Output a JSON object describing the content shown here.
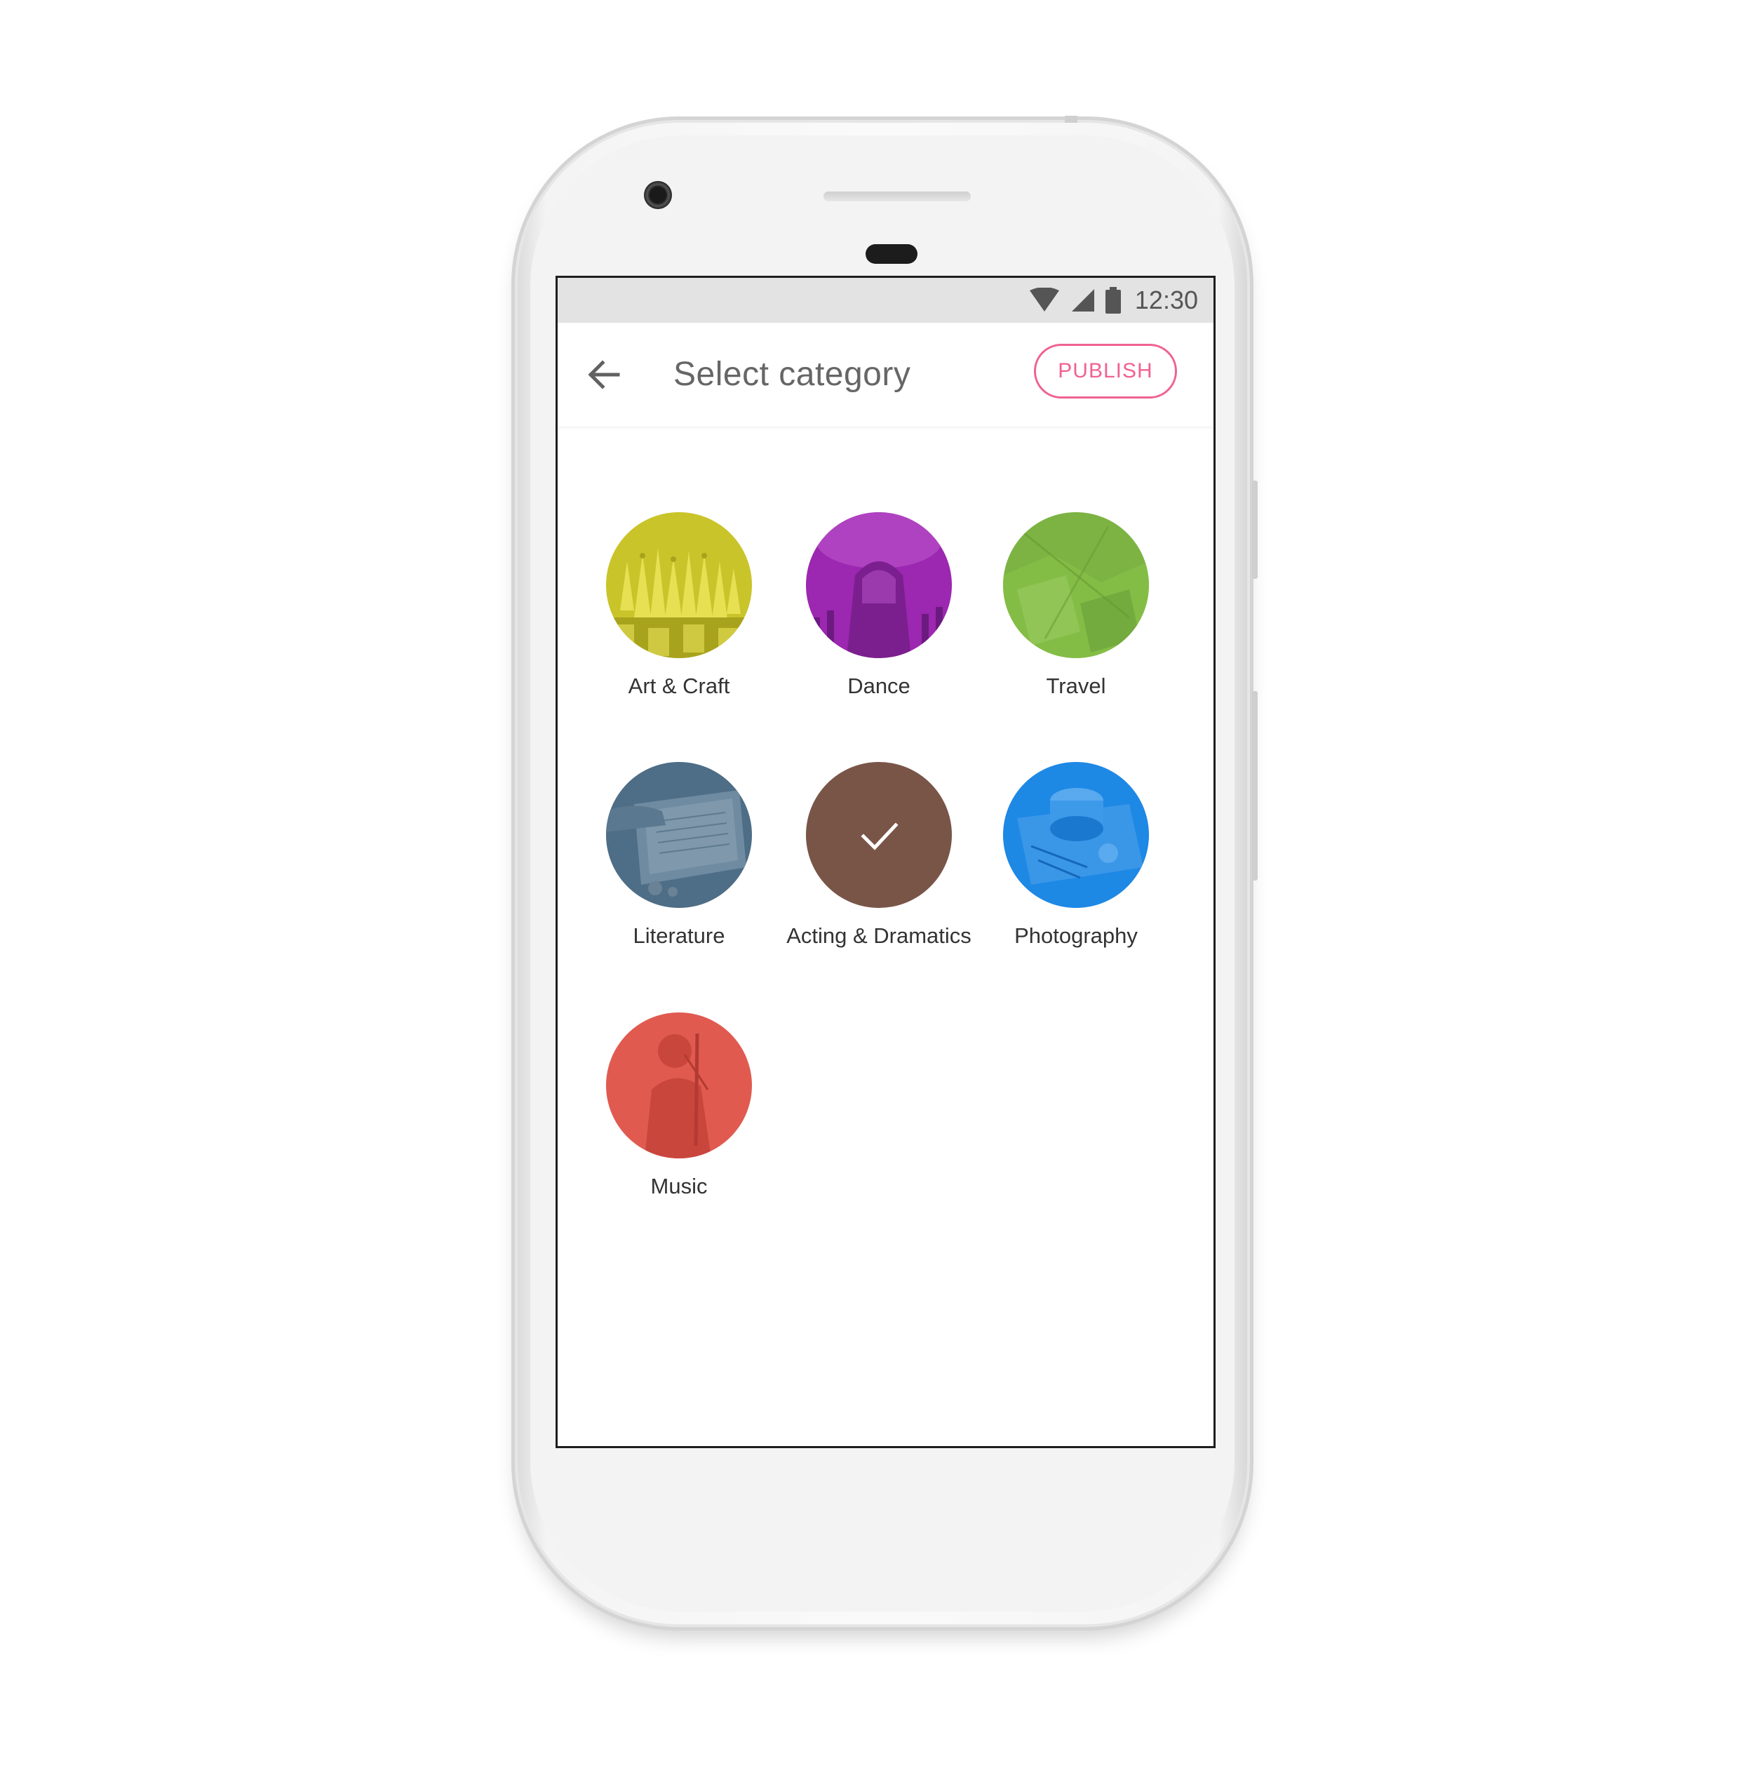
{
  "status_bar": {
    "time": "12:30",
    "icons": [
      "wifi-icon",
      "signal-icon",
      "battery-icon"
    ]
  },
  "app_bar": {
    "back_icon": "arrow-back-icon",
    "title": "Select category",
    "publish_label": "PUBLISH",
    "accent_color": "#f06292"
  },
  "categories": [
    {
      "label": "Art & Craft",
      "color": "#c9c42a",
      "image": "pencils",
      "selected": false
    },
    {
      "label": "Dance",
      "color": "#9c27b0",
      "image": "concert",
      "selected": false
    },
    {
      "label": "Travel",
      "color": "#7cb342",
      "image": "map",
      "selected": false
    },
    {
      "label": "Literature",
      "color": "#4e6d86",
      "image": "book",
      "selected": false
    },
    {
      "label": "Acting & Dramatics",
      "color": "#795548",
      "image": "check-icon",
      "selected": true
    },
    {
      "label": "Photography",
      "color": "#1e88e5",
      "image": "camera",
      "selected": false
    },
    {
      "label": "Music",
      "color": "#e05a50",
      "image": "violinist",
      "selected": false
    }
  ]
}
